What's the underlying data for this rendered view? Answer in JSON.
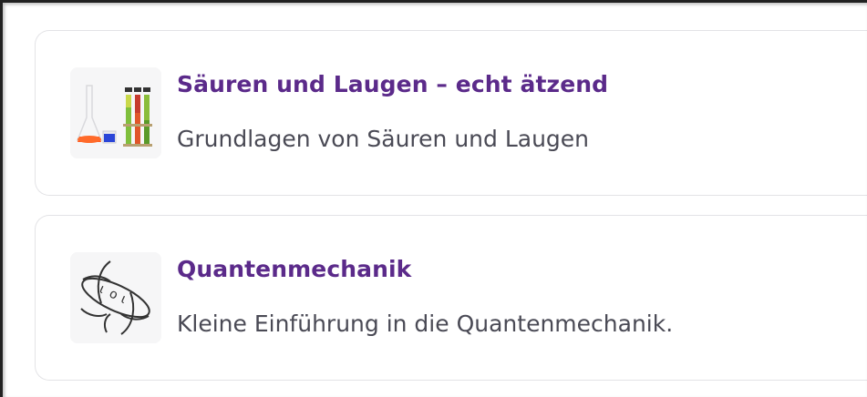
{
  "courses": [
    {
      "title": "Säuren und Laugen – echt ätzend",
      "subtitle": "Grundlagen von Säuren und Laugen",
      "thumbnail_icon": "lab-glassware-icon"
    },
    {
      "title": "Quantenmechanik",
      "subtitle": "Kleine Einführung in die Quantenmechanik.",
      "thumbnail_icon": "atom-icon"
    }
  ],
  "colors": {
    "title": "#5b2a8a",
    "subtitle": "#4a4a55",
    "card_border": "#e3e3e6",
    "thumb_bg": "#f4f4f5"
  }
}
